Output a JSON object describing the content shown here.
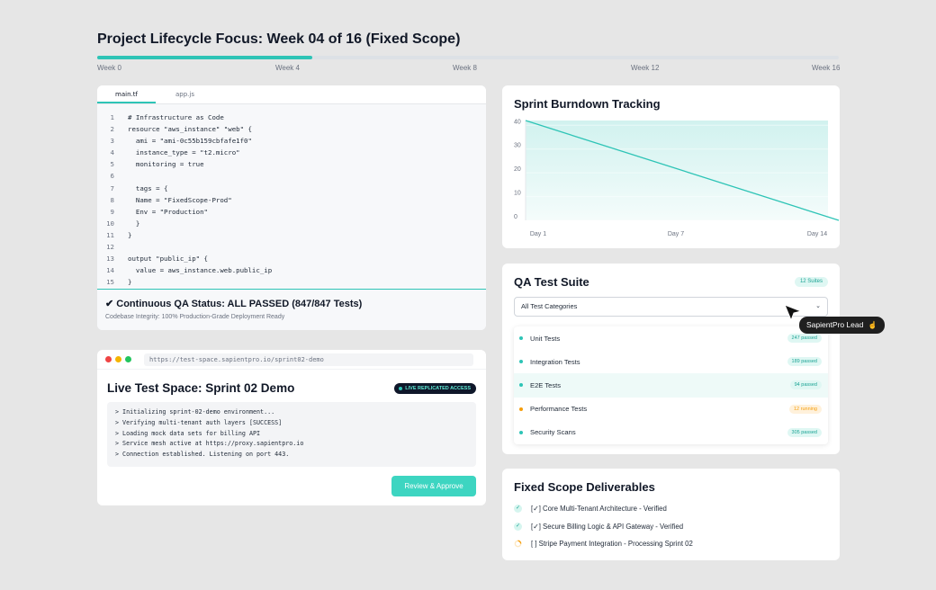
{
  "header": {
    "title": "Project Lifecycle Focus: Week 04 of 16 (Fixed Scope)",
    "progress_percent": 29,
    "weeks": [
      "Week 0",
      "Week 4",
      "Week 8",
      "Week 12",
      "Week 16"
    ]
  },
  "editor": {
    "tabs": [
      "main.tf",
      "app.js"
    ],
    "active_tab": "main.tf",
    "lines": [
      {
        "n": "1",
        "t": "# Infrastructure as Code"
      },
      {
        "n": "2",
        "t": "resource \"aws_instance\" \"web\" {"
      },
      {
        "n": "3",
        "t": "  ami = \"ami-0c55b159cbfafe1f0\""
      },
      {
        "n": "4",
        "t": "  instance_type = \"t2.micro\""
      },
      {
        "n": "5",
        "t": "  monitoring = true"
      },
      {
        "n": "6",
        "t": ""
      },
      {
        "n": "7",
        "t": "  tags = {"
      },
      {
        "n": "8",
        "t": "  Name = \"FixedScope-Prod\""
      },
      {
        "n": "9",
        "t": "  Env = \"Production\""
      },
      {
        "n": "10",
        "t": "  }"
      },
      {
        "n": "11",
        "t": "}"
      },
      {
        "n": "12",
        "t": ""
      },
      {
        "n": "13",
        "t": "output \"public_ip\" {"
      },
      {
        "n": "14",
        "t": "  value = aws_instance.web.public_ip"
      },
      {
        "n": "15",
        "t": "}"
      }
    ],
    "qa_status": "✔ Continuous QA Status: ALL PASSED (847/847 Tests)",
    "qa_subtitle": "Codebase Integrity: 100% Production-Grade Deployment Ready"
  },
  "test_space": {
    "url": "https://test-space.sapientpro.io/sprint02-demo",
    "title": "Live Test Space: Sprint 02 Demo",
    "badge": "LIVE REPLICATED ACCESS",
    "terminal": [
      "> Initializing sprint-02-demo environment...",
      "> Verifying multi-tenant auth layers [SUCCESS]",
      "> Loading mock data sets for billing API",
      "> Service mesh active at https://proxy.sapientpro.io",
      "> Connection established. Listening on port 443."
    ],
    "button": "Review & Approve"
  },
  "burndown": {
    "title": "Sprint Burndown Tracking"
  },
  "chart_data": {
    "type": "area",
    "title": "Sprint Burndown Tracking",
    "categories": [
      "Day 1",
      "Day 7",
      "Day 14"
    ],
    "x": [
      1,
      14
    ],
    "series": [
      {
        "values": [
          42,
          0
        ]
      }
    ],
    "yticks": [
      0,
      10,
      20,
      30,
      40
    ],
    "ylim": [
      0,
      42
    ],
    "grid": true,
    "color": "#2ec4b6"
  },
  "qa_suite": {
    "title": "QA Test Suite",
    "badge": "12 Suites",
    "select_value": "All Test Categories",
    "items": [
      {
        "label": "Unit Tests",
        "status": "247 passed",
        "state": "ok"
      },
      {
        "label": "Integration Tests",
        "status": "189 passed",
        "state": "ok"
      },
      {
        "label": "E2E Tests",
        "status": "94 passed",
        "state": "ok"
      },
      {
        "label": "Performance Tests",
        "status": "12 running",
        "state": "run"
      },
      {
        "label": "Security Scans",
        "status": "305 passed",
        "state": "ok"
      }
    ],
    "tooltip": "SapientPro Lead"
  },
  "deliverables": {
    "title": "Fixed Scope Deliverables",
    "items": [
      {
        "label": "[✓] Core Multi-Tenant Architecture - Verified",
        "state": "done"
      },
      {
        "label": "[✓] Secure Billing Logic & API Gateway - Verified",
        "state": "done"
      },
      {
        "label": "[ ] Stripe Payment Integration - Processing Sprint 02",
        "state": "progress"
      }
    ]
  },
  "colors": {
    "accent": "#2ec4b6",
    "warning": "#f59e0b",
    "dark": "#0f172a"
  }
}
